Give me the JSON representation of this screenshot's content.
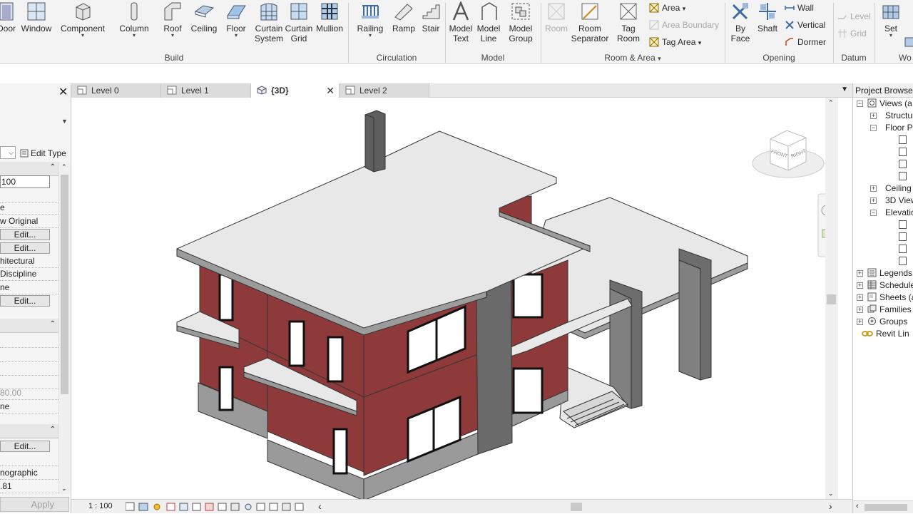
{
  "ribbon": {
    "build": {
      "door": "Door",
      "window": "Window",
      "component": "Component",
      "column": "Column",
      "roof": "Roof",
      "ceiling": "Ceiling",
      "floor": "Floor",
      "curtain_system_1": "Curtain",
      "curtain_system_2": "System",
      "curtain_grid_1": "Curtain",
      "curtain_grid_2": "Grid",
      "mullion": "Mullion",
      "panel_label": "Build"
    },
    "circulation": {
      "railing": "Railing",
      "ramp": "Ramp",
      "stair": "Stair",
      "panel_label": "Circulation"
    },
    "model": {
      "model_text_1": "Model",
      "model_text_2": "Text",
      "model_line_1": "Model",
      "model_line_2": "Line",
      "model_group_1": "Model",
      "model_group_2": "Group",
      "panel_label": "Model"
    },
    "room_area": {
      "room": "Room",
      "room_separator_1": "Room",
      "room_separator_2": "Separator",
      "tag_room_1": "Tag",
      "tag_room_2": "Room",
      "area": "Area",
      "area_boundary": "Area  Boundary",
      "tag_area": "Tag  Area",
      "panel_label": "Room & Area"
    },
    "opening": {
      "by_face_1": "By",
      "by_face_2": "Face",
      "shaft": "Shaft",
      "wall": "Wall",
      "vertical": "Vertical",
      "dormer": "Dormer",
      "panel_label": "Opening"
    },
    "datum": {
      "level": "Level",
      "grid": "Grid",
      "panel_label": "Datum"
    },
    "workplane": {
      "set": "Set",
      "panel_label": "Wo"
    }
  },
  "properties": {
    "edit_type": "Edit Type",
    "scale_value": "100",
    "rows": [
      "e",
      "w Original",
      "hitectural",
      "Discipline",
      "ne",
      "80.00",
      "ne",
      "nographic",
      ".81"
    ],
    "edit_label": "Edit...",
    "apply": "Apply"
  },
  "tabs": [
    {
      "label": "Level 0"
    },
    {
      "label": "Level 1"
    },
    {
      "label": "{3D}"
    },
    {
      "label": "Level 2"
    }
  ],
  "viewcube": {
    "front": "FRONT",
    "right": "RIGHT"
  },
  "project_browser": {
    "title": "Project Browser",
    "items": [
      "Views (a",
      "Structur",
      "Floor Pl",
      "Ceiling",
      "3D View",
      "Elevatic",
      "Legends",
      "Schedule",
      "Sheets (a",
      "Families",
      "Groups",
      "Revit Lin"
    ]
  },
  "statusbar": {
    "scale": "1 : 100"
  },
  "colors": {
    "brick": "#8e3a3a",
    "slab": "#e8e8e8",
    "concrete": "#6a6a6a",
    "ribbon_bg": "#f3f3f3"
  }
}
